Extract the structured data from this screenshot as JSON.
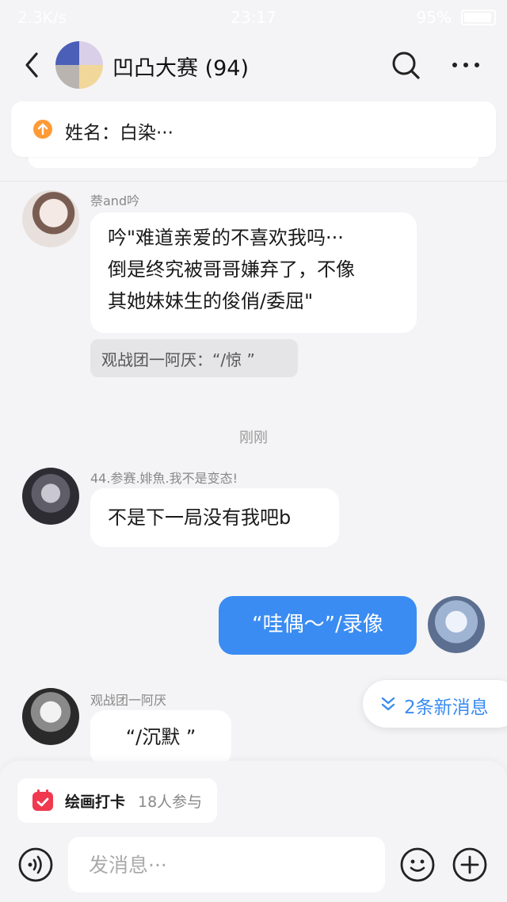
{
  "status_bar": {
    "network_speed": "2.3K/s",
    "time": "23:17",
    "battery": "95%"
  },
  "header": {
    "title": "凹凸大赛 (94)"
  },
  "notice": {
    "text": "姓名：白染···"
  },
  "messages": [
    {
      "sender": "萘and吟",
      "text_lines": [
        "吟\"难道亲爱的不喜欢我吗···",
        "倒是终究被哥哥嫌弃了，不像",
        "其她妹妹生的俊俏/委屈\""
      ],
      "quote": "观战团一阿厌：“/惊 ”"
    },
    {
      "timestamp": "刚刚"
    },
    {
      "sender": "44.参赛.婔魚.我不是变态!",
      "text": "不是下一局没有我吧b"
    },
    {
      "mine": true,
      "text": "“哇偶～”/录像"
    },
    {
      "sender": "观战团一阿厌",
      "text": "“/沉默 ”"
    }
  ],
  "new_messages": {
    "label": "2条新消息"
  },
  "checkin": {
    "title": "绘画打卡",
    "count": "18人参与"
  },
  "input": {
    "placeholder": "发消息···"
  },
  "colors": {
    "accent": "#3a8cf2",
    "notice_icon": "#ff9a36",
    "checkin_icon": "#f0384f",
    "background": "#f4f4f6"
  },
  "icons": [
    "back-arrow-icon",
    "search-icon",
    "more-dots-icon",
    "upload-arrow-icon",
    "calendar-icon",
    "voice-icon",
    "emoji-icon",
    "plus-icon",
    "chevron-down-double-icon"
  ]
}
